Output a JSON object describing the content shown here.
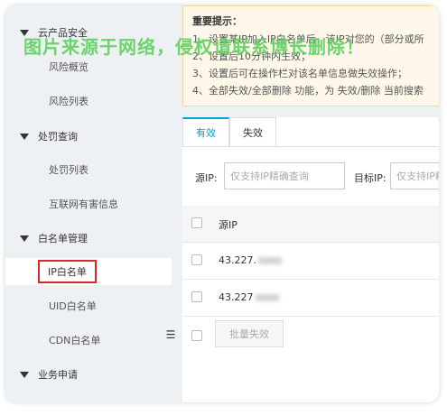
{
  "sidebar": {
    "groups": [
      {
        "label": "云产品安全"
      },
      {
        "label": "处罚查询"
      },
      {
        "label": "白名单管理"
      },
      {
        "label": "业务申请"
      }
    ],
    "items": [
      {
        "label": "风险概览"
      },
      {
        "label": "风险列表"
      },
      {
        "label": "处罚列表"
      },
      {
        "label": "互联网有害信息"
      },
      {
        "label": "IP白名单"
      },
      {
        "label": "UID白名单"
      },
      {
        "label": "CDN白名单"
      }
    ],
    "collapse_glyph": "☰"
  },
  "notice": {
    "title": "重要提示：",
    "lines": [
      "1、设置某IP加入IP白名单后，该IP对您的（部分或所",
      "2、设置后10分钟内生效；",
      "3、设置后可在操作栏对该名单信息做失效操作；",
      "4、全部失效/全部删除 功能，为 失效/删除 当前搜索"
    ]
  },
  "tabs": [
    {
      "label": "有效"
    },
    {
      "label": "失效"
    }
  ],
  "filter": {
    "source_ip_label": "源IP:",
    "source_ip_placeholder": "仅支持IP精确查询",
    "target_ip_label": "目标IP:",
    "target_ip_placeholder": "仅支持IP精确查询"
  },
  "table": {
    "header": "源IP",
    "rows": [
      {
        "ip": "43.227."
      },
      {
        "ip": "43.227"
      }
    ],
    "batch_button": "批量失效"
  },
  "watermark": "图片来源于网络，侵权请联系博长删除！"
}
